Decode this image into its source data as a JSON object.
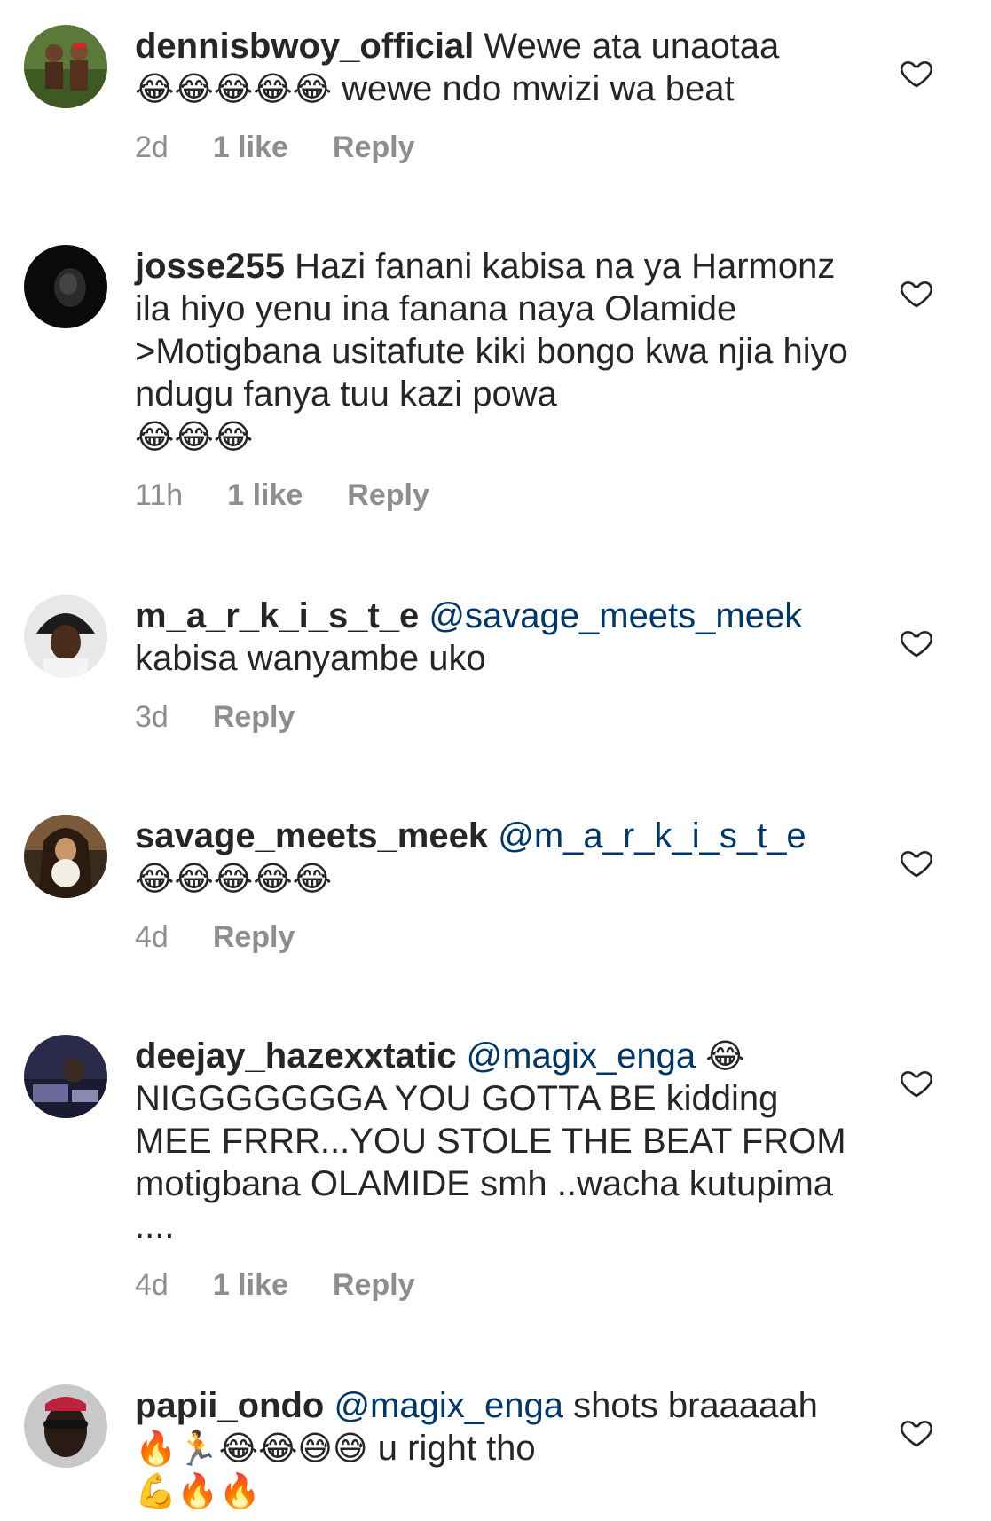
{
  "comments": [
    {
      "username": "dennisbwoy_official",
      "text_before": "Wewe ata unaotaa",
      "emojis": "😂😂😂😂😂",
      "text_after": " wewe ndo mwizi wa beat",
      "time": "2d",
      "likes": "1 like",
      "reply": "Reply"
    },
    {
      "username": "josse255",
      "text": "Hazi fanani kabisa na ya Harmonz ila hiyo yenu ina fanana naya Olamide >Motigbana usitafute kiki bongo kwa njia hiyo ndugu fanya tuu kazi powa",
      "emojis": "😂😂😂",
      "time": "11h",
      "likes": "1 like",
      "reply": "Reply"
    },
    {
      "username": "m_a_r_k_i_s_t_e",
      "mention": "@savage_meets_meek",
      "text": "kabisa wanyambe uko",
      "time": "3d",
      "reply": "Reply"
    },
    {
      "username": "savage_meets_meek",
      "mention": "@m_a_r_k_i_s_t_e",
      "emojis": "😂😂😂😂😂",
      "time": "4d",
      "reply": "Reply"
    },
    {
      "username": "deejay_hazexxtatic",
      "mention": "@magix_enga",
      "emoji_inline": "😂",
      "text": "NIGGGGGGGA YOU GOTTA BE kidding MEE FRRR...YOU STOLE THE BEAT FROM motigbana OLAMIDE smh ..wacha kutupima ....",
      "time": "4d",
      "likes": "1 like",
      "reply": "Reply"
    },
    {
      "username": "papii_ondo",
      "mention": "@magix_enga",
      "text_before": "shots braaaaah",
      "emojis": "🔥🏃😂😂😅😅",
      "text_after": " u right tho",
      "emojis_end": "💪🔥🔥"
    }
  ],
  "colors": {
    "text": "#262626",
    "meta": "#8e8e8e",
    "mention": "#00376b",
    "heart_outline": "#262626"
  },
  "icons": {
    "like": "heart-outline-icon"
  }
}
